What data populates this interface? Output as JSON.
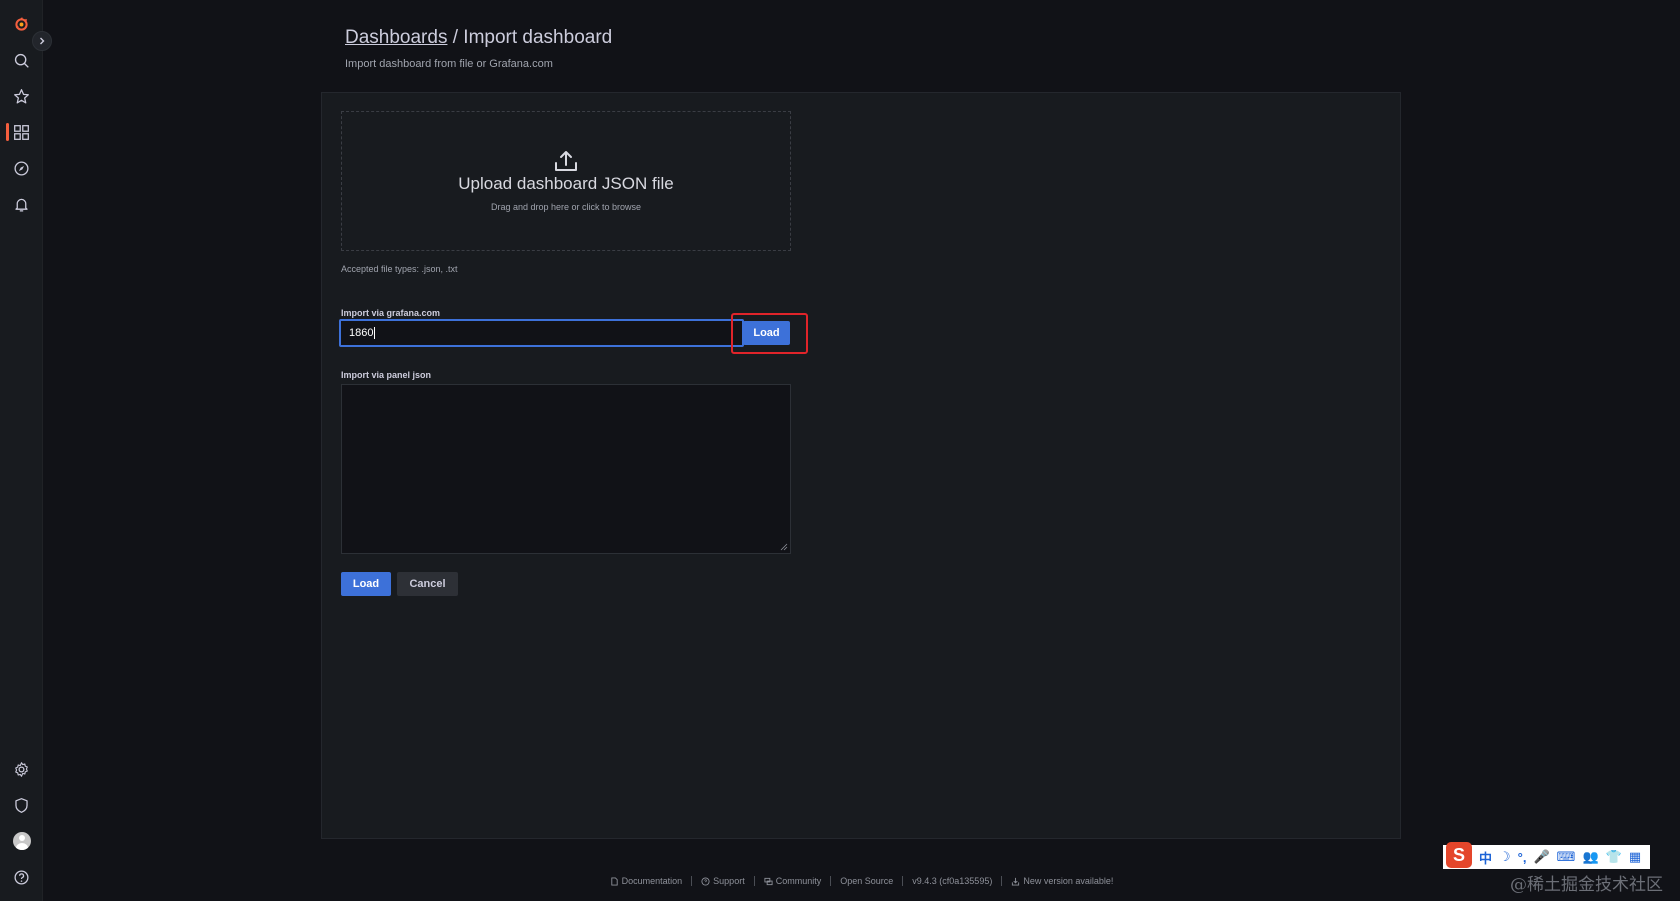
{
  "breadcrumb": {
    "parent": "Dashboards",
    "separator": " / ",
    "current": "Import dashboard"
  },
  "subtitle": "Import dashboard from file or Grafana.com",
  "upload": {
    "title": "Upload dashboard JSON file",
    "hint": "Drag and drop here or click to browse",
    "accepted": "Accepted file types: .json, .txt"
  },
  "gcom": {
    "label": "Import via grafana.com",
    "value": "1860",
    "load_label": "Load"
  },
  "panel_json": {
    "label": "Import via panel json",
    "value": ""
  },
  "actions": {
    "load": "Load",
    "cancel": "Cancel"
  },
  "footer": {
    "documentation": "Documentation",
    "support": "Support",
    "community": "Community",
    "open_source": "Open Source",
    "version": "v9.4.3 (cf0a135595)",
    "new_version": "New version available!"
  },
  "sidebar": {
    "icons": [
      "grafana-logo-icon",
      "search-icon",
      "star-icon",
      "dashboards-icon",
      "explore-icon",
      "alerting-bell-icon",
      "settings-gear-icon",
      "shield-icon",
      "avatar",
      "help-icon"
    ],
    "active": "dashboards-icon"
  },
  "ime": {
    "logo": "S",
    "items": [
      "中",
      "☽",
      "°,",
      "🎤",
      "⌨",
      "👥",
      "👕",
      "▦"
    ]
  },
  "watermark": "@稀土掘金技术社区",
  "colors": {
    "background": "#111217",
    "panel": "#181b1f",
    "primary": "#3d71d9",
    "highlight": "#e0242a",
    "brand": "#f55f3e"
  }
}
